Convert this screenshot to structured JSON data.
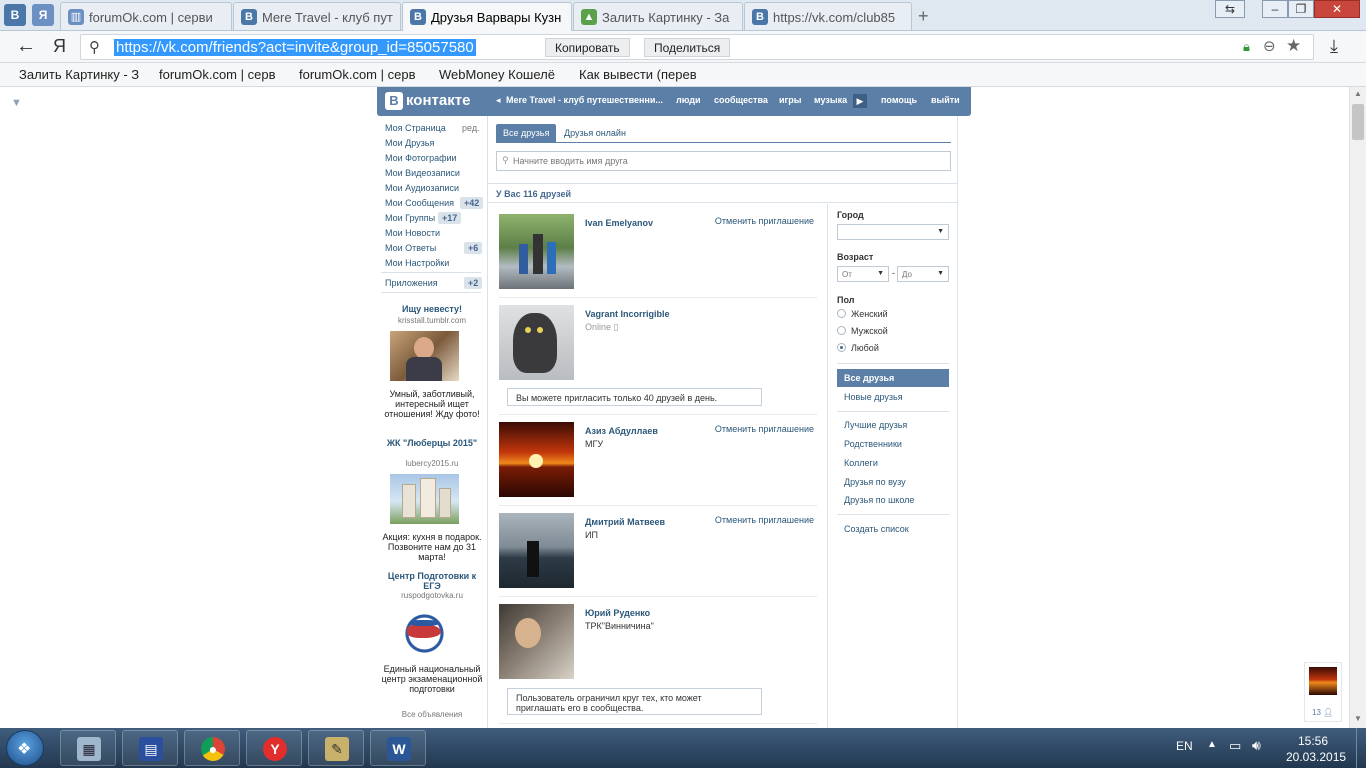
{
  "browser": {
    "pinned": [
      "В",
      "Я"
    ],
    "tabs": [
      {
        "title": "forumOk.com | серви",
        "favicon": "book-icon"
      },
      {
        "title": "Mere Travel - клуб пут",
        "favicon": "vk-icon"
      },
      {
        "title": "Друзья Варвары Кузн",
        "favicon": "vk-icon",
        "active": true
      },
      {
        "title": "Залить Картинку - За",
        "favicon": "photo-icon"
      },
      {
        "title": "https://vk.com/club85",
        "favicon": "vk-icon"
      }
    ],
    "new_tab": "+",
    "back": "←",
    "yandex": "Я",
    "url": "https://vk.com/friends?act=invite&group_id=85057580",
    "copy_label": "Копировать",
    "share_label": "Поделиться",
    "bookmarks": [
      "Залить Картинку - З",
      "forumOk.com | серв",
      "forumOk.com | серв",
      "WebMoney Кошелё",
      "Как вывести (перев"
    ]
  },
  "vk": {
    "logo_letter": "В",
    "logo_text": "контакте",
    "nav": {
      "group": "Mere Travel - клуб путешественни...",
      "people": "люди",
      "communities": "сообщества",
      "games": "игры",
      "music": "музыка",
      "help": "помощь",
      "logout": "выйти"
    },
    "sidebar": {
      "edit": "ред.",
      "items": [
        {
          "label": "Моя Страница"
        },
        {
          "label": "Мои Друзья"
        },
        {
          "label": "Мои Фотографии"
        },
        {
          "label": "Мои Видеозаписи"
        },
        {
          "label": "Мои Аудиозаписи"
        },
        {
          "label": "Мои Сообщения",
          "badge": "+42"
        },
        {
          "label": "Мои Группы",
          "badge": "+17"
        },
        {
          "label": "Мои Новости"
        },
        {
          "label": "Мои Ответы",
          "badge": "+6"
        },
        {
          "label": "Мои Настройки"
        }
      ],
      "apps": {
        "label": "Приложения",
        "badge": "+2"
      },
      "ads": [
        {
          "title": "Ищу невесту!",
          "domain": "krisstall.tumblr.com",
          "text": "Умный, заботливый, интересный ищет отношения! Жду фото!"
        },
        {
          "title": "ЖК \"Люберцы 2015\"",
          "domain": "lubercy2015.ru",
          "text": "Акция: кухня в подарок. Позвоните нам до 31 марта!"
        },
        {
          "title": "Центр Подготовки к ЕГЭ",
          "domain": "ruspodgotovka.ru",
          "text": "Единый национальный центр экзаменационной подготовки"
        }
      ],
      "all_ads": "Все объявления"
    },
    "tabs": {
      "all": "Все друзья",
      "online": "Друзья онлайн"
    },
    "search_placeholder": "Начните вводить имя друга",
    "friends_count": "У Вас 116 друзей",
    "friends": [
      {
        "name": "Ivan Emelyanov",
        "sub": "",
        "action": "Отменить приглашение"
      },
      {
        "name": "Vagrant Incorrigible",
        "sub": "Online",
        "action": "",
        "notice": "Вы можете пригласить только 40 друзей в день."
      },
      {
        "name": "Азиз Абдуллаев",
        "sub": "МГУ",
        "action": "Отменить приглашение"
      },
      {
        "name": "Дмитрий Матвеев",
        "sub": "ИП",
        "action": "Отменить приглашение"
      },
      {
        "name": "Юрий Руденко",
        "sub": "ТРК\"Винничина\"",
        "action": "",
        "notice": "Пользователь ограничил круг тех, кто может приглашать его в сообщества."
      }
    ],
    "filters": {
      "city_label": "Город",
      "age_label": "Возраст",
      "age_from": "От",
      "age_dash": "-",
      "age_to": "До",
      "sex_label": "Пол",
      "sex_options": [
        {
          "label": "Женский",
          "checked": false
        },
        {
          "label": "Мужской",
          "checked": false
        },
        {
          "label": "Любой",
          "checked": true
        }
      ],
      "lists": [
        "Все друзья",
        "Новые друзья"
      ],
      "lists2": [
        "Лучшие друзья",
        "Родственники",
        "Коллеги",
        "Друзья по вузу",
        "Друзья по школе"
      ],
      "create_list": "Создать список"
    },
    "im_count": "13"
  },
  "taskbar": {
    "lang": "EN",
    "time": "15:56",
    "date": "20.03.2015"
  },
  "colors": {
    "vk_blue": "#5b7fa6",
    "link": "#2b587a",
    "highlight": "#3399ff"
  }
}
